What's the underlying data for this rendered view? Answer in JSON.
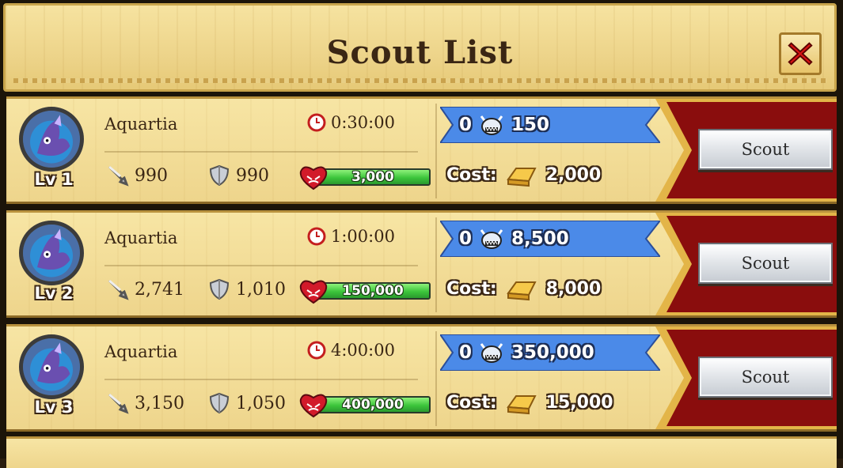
{
  "header": {
    "title": "Scout List",
    "close_icon": "close-x-icon"
  },
  "colors": {
    "accent_red": "#8a0d0d",
    "banner_blue": "#3f7fe0",
    "hp_green": "#3cc53b",
    "parchment": "#f2dc93"
  },
  "rows": [
    {
      "name": "Aquartia",
      "level": "Lv 1",
      "time": "0:30:00",
      "attack": "990",
      "defense": "990",
      "hp": "3,000",
      "hp_fill": 1.0,
      "banner_count": "0",
      "banner_value": "150",
      "cost_label": "Cost:",
      "cost": "2,000",
      "button": "Scout"
    },
    {
      "name": "Aquartia",
      "level": "Lv 2",
      "time": "1:00:00",
      "attack": "2,741",
      "defense": "1,010",
      "hp": "150,000",
      "hp_fill": 1.0,
      "banner_count": "0",
      "banner_value": "8,500",
      "cost_label": "Cost:",
      "cost": "8,000",
      "button": "Scout"
    },
    {
      "name": "Aquartia",
      "level": "Lv 3",
      "time": "4:00:00",
      "attack": "3,150",
      "defense": "1,050",
      "hp": "400,000",
      "hp_fill": 1.0,
      "banner_count": "0",
      "banner_value": "350,000",
      "cost_label": "Cost:",
      "cost": "15,000",
      "button": "Scout"
    }
  ]
}
